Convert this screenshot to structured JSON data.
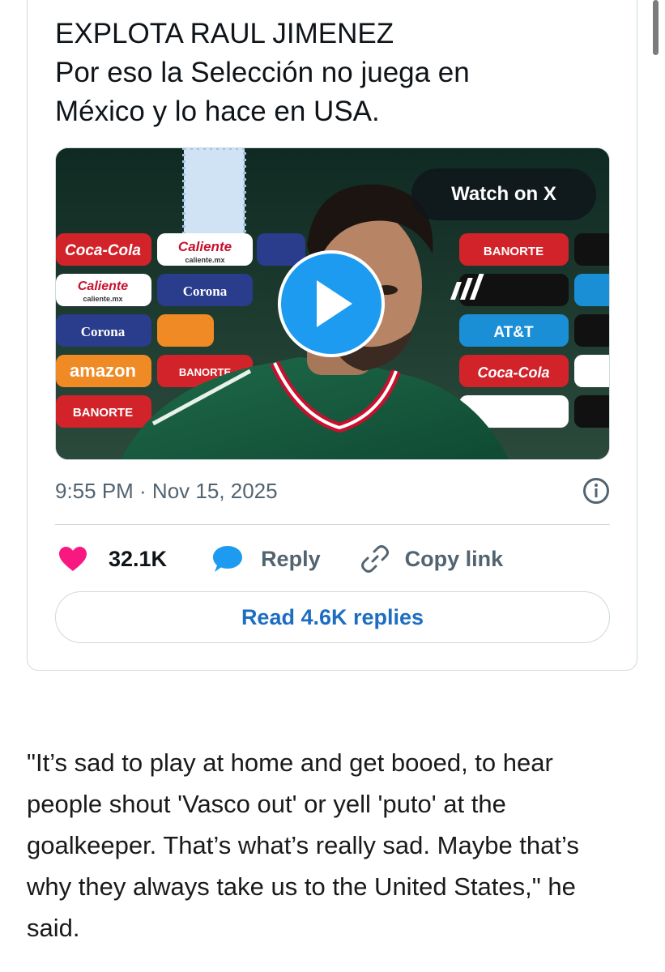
{
  "tweet": {
    "text_lines": [
      "EXPLOTA RAUL JIMENEZ",
      "Por  eso la Selección no juega en",
      "México y lo hace en USA."
    ],
    "watch_label": "Watch on X",
    "media_sponsors": [
      "Coca-Cola",
      "Caliente",
      "caliente.mx",
      "Corona",
      "amazon",
      "BANORTE",
      "AT&T"
    ],
    "timestamp": "9:55 PM · Nov 15, 2025",
    "likes": "32.1K",
    "reply_label": "Reply",
    "copy_label": "Copy link",
    "read_replies": "Read 4.6K replies"
  },
  "colors": {
    "like": "#f91880",
    "reply": "#1d9bf0",
    "link": "#1d6ec2",
    "secondary_text": "#536471"
  },
  "article": {
    "lines": [
      "\"It’s sad to play at home and get booed, to hear",
      "people shout 'Vasco out' or yell 'puto' at the",
      "goalkeeper. That’s what’s really sad. Maybe that’s",
      "why they always take us to the United States,\" he",
      "said."
    ]
  }
}
